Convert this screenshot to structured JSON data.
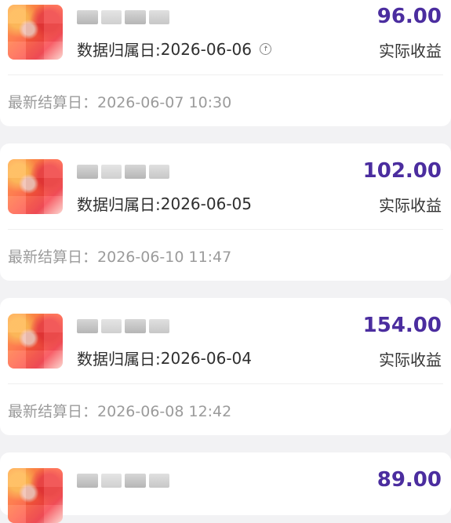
{
  "labels": {
    "data_date": "数据归属日: ",
    "settle_date": "最新结算日：",
    "amount_label": "实际收益"
  },
  "colors": {
    "amount": "#4b2d9f",
    "background": "#f2f2f4"
  },
  "items": [
    {
      "date": "2026-06-06",
      "amount": "96.00",
      "settlement": "2026-06-07 10:30",
      "has_info_icon": true
    },
    {
      "date": "2026-06-05",
      "amount": "102.00",
      "settlement": "2026-06-10 11:47",
      "has_info_icon": false
    },
    {
      "date": "2026-06-04",
      "amount": "154.00",
      "settlement": "2026-06-08 12:42",
      "has_info_icon": false
    },
    {
      "amount": "89.00"
    }
  ]
}
